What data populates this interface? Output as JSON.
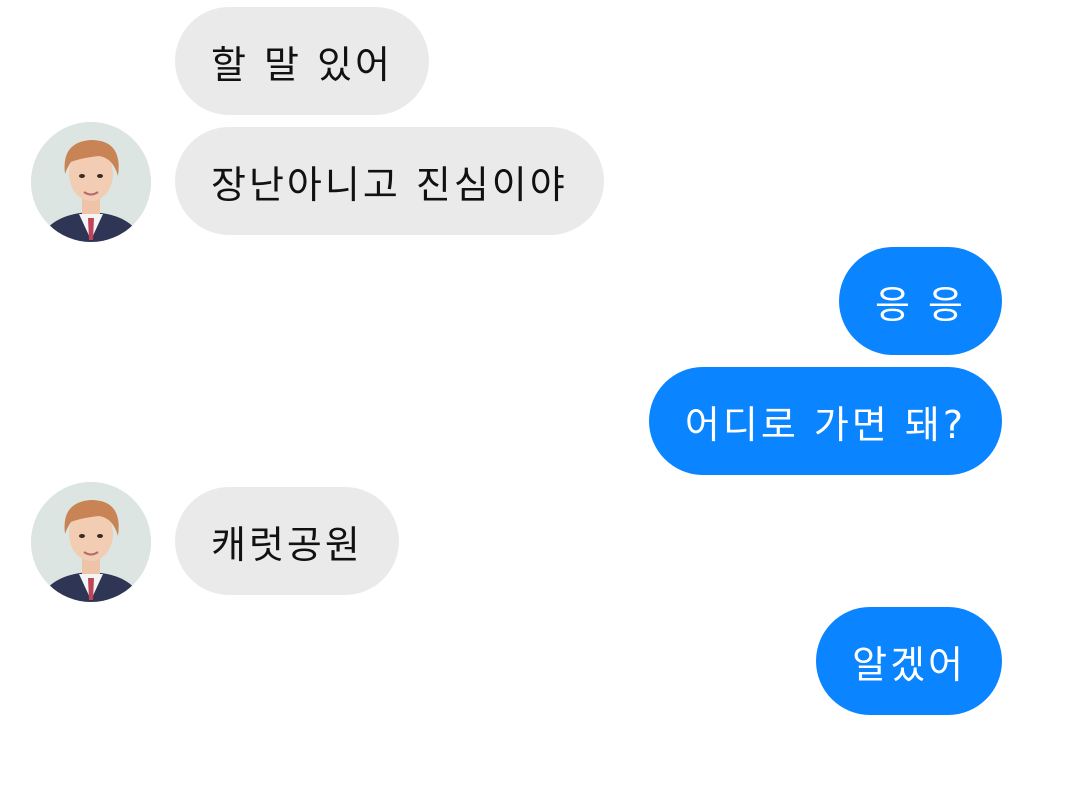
{
  "conversation": {
    "messages": [
      {
        "direction": "incoming",
        "text": "할 말 있어"
      },
      {
        "direction": "incoming",
        "text": "장난아니고 진심이야",
        "avatar": "contact-avatar"
      },
      {
        "direction": "outgoing",
        "text": "응 응"
      },
      {
        "direction": "outgoing",
        "text": "어디로 가면 돼?"
      },
      {
        "direction": "incoming",
        "text": "캐럿공원",
        "avatar": "contact-avatar"
      },
      {
        "direction": "outgoing",
        "text": "알겠어"
      }
    ]
  },
  "colors": {
    "incoming_bubble": "#eaeaea",
    "outgoing_bubble": "#0a84ff",
    "incoming_text": "#111111",
    "outgoing_text": "#ffffff"
  }
}
